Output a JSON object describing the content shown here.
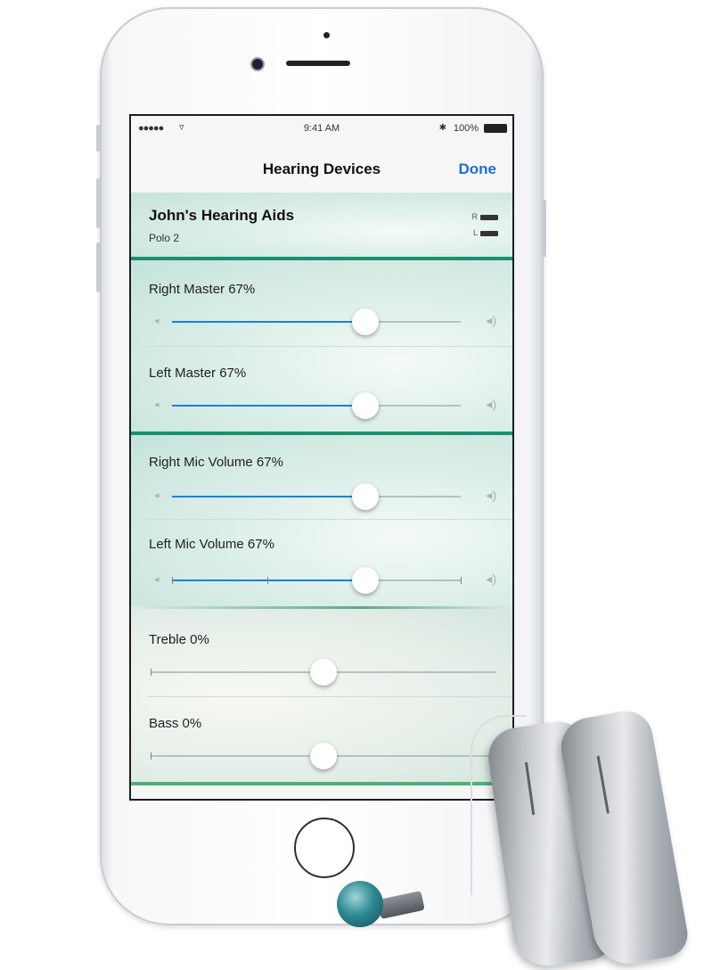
{
  "status_bar": {
    "signal": "●●●●● ",
    "wifi": "wifi-icon",
    "time": "9:41 AM",
    "battery": "100%"
  },
  "nav": {
    "title": "Hearing Devices",
    "done": "Done"
  },
  "device": {
    "name": "John's Hearing Aids",
    "model": "Polo 2",
    "right_label": "R",
    "left_label": "L"
  },
  "sliders": [
    {
      "label": "Right Master  67%",
      "value": 0.67
    },
    {
      "label": "Left Master  67%",
      "value": 0.67
    },
    {
      "label": "Right Mic Volume  67%",
      "value": 0.67
    },
    {
      "label": "Left Mic Volume  67%",
      "value": 0.67
    },
    {
      "label": "Treble 0%",
      "value": 0.5
    },
    {
      "label": "Bass 0%",
      "value": 0.5
    }
  ],
  "colors": {
    "accent": "#1e7fd8",
    "section_bar": "#1b8f70"
  }
}
